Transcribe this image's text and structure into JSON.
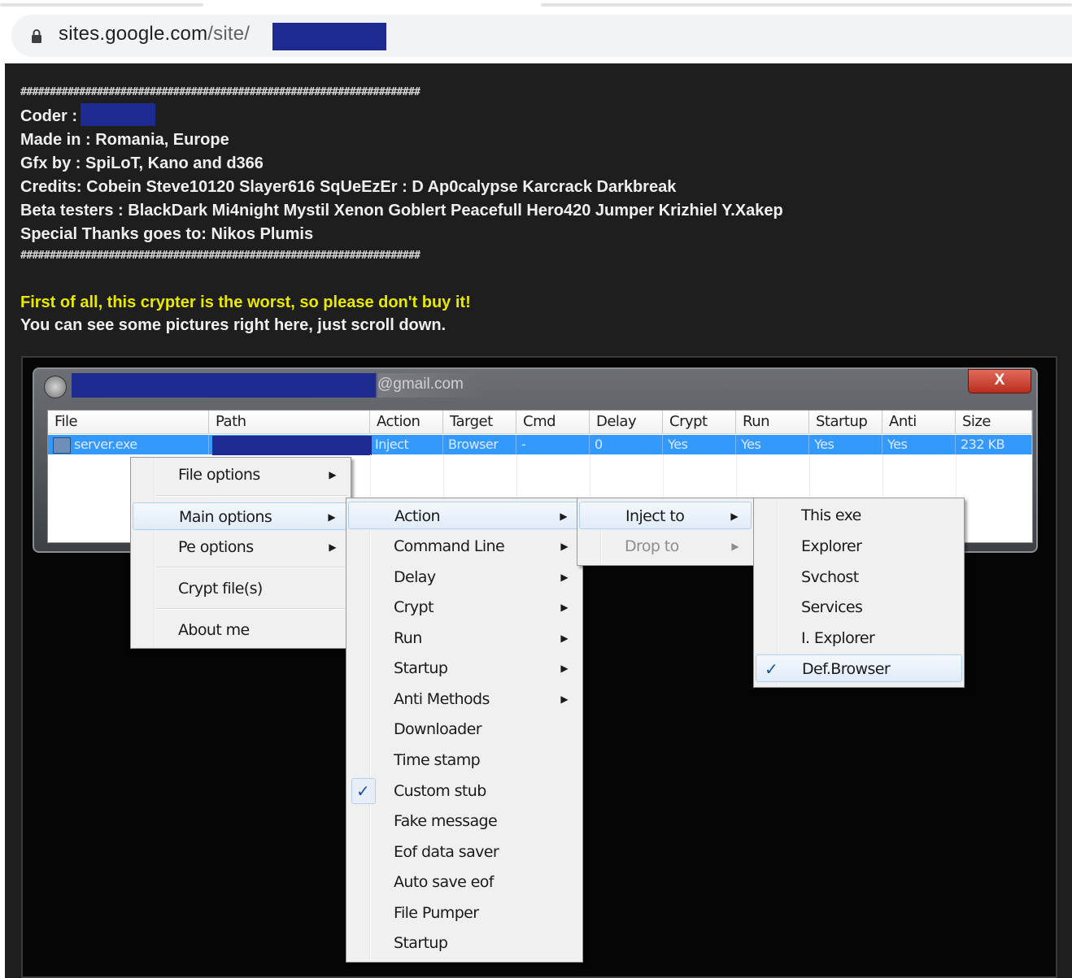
{
  "browser": {
    "url_domain": "sites.google.com",
    "url_path": "/site/"
  },
  "page": {
    "hash_line": "####################################################################",
    "coder_label": "Coder :",
    "made_in": "Made in : Romania, Europe",
    "gfx_by": "Gfx by : SpiLoT, Kano and d366",
    "credits": "Credits: Cobein Steve10120 Slayer616 SqUeEzEr : D Ap0calypse Karcrack Darkbreak",
    "beta_testers": "Beta testers : BlackDark Mi4night Mystil Xenon Goblert Peacefull Hero420 Jumper Krizhiel Y.Xakep",
    "special_thanks": "Special Thanks goes to: Nikos Plumis",
    "warning": "First of all, this crypter is the worst, so please don't buy it!",
    "scroll_note": "You can see some pictures right here, just scroll down.",
    "warning_color": "#e8e800"
  },
  "app": {
    "title_suffix": "@gmail.com",
    "close_glyph": "X",
    "columns": [
      "File",
      "Path",
      "Action",
      "Target",
      "Cmd",
      "Delay",
      "Crypt",
      "Run",
      "Startup",
      "Anti",
      "Size"
    ],
    "row": {
      "file": "server.exe",
      "action": "Inject",
      "target": "Browser",
      "cmd": "-",
      "delay": "0",
      "crypt": "Yes",
      "run": "Yes",
      "startup": "Yes",
      "anti": "Yes",
      "size": "232 KB"
    },
    "selection_color": "#3399ff"
  },
  "menus": {
    "main": {
      "file_options": "File options",
      "main_options": "Main options",
      "pe_options": "Pe options",
      "crypt_files": "Crypt file(s)",
      "about_me": "About me"
    },
    "main_options": {
      "action": "Action",
      "command_line": "Command Line",
      "delay": "Delay",
      "crypt": "Crypt",
      "run": "Run",
      "startup": "Startup",
      "anti_methods": "Anti Methods",
      "downloader": "Downloader",
      "time_stamp": "Time stamp",
      "custom_stub": "Custom stub",
      "fake_message": "Fake message",
      "eof_data_saver": "Eof data saver",
      "auto_save_eof": "Auto save eof",
      "file_pumper": "File Pumper",
      "startup2": "Startup"
    },
    "action": {
      "inject_to": "Inject to",
      "drop_to": "Drop to"
    },
    "inject_to": {
      "this_exe": "This exe",
      "explorer": "Explorer",
      "svchost": "Svchost",
      "services": "Services",
      "i_explorer": "I. Explorer",
      "def_browser": "Def.Browser"
    },
    "arrow": "▶",
    "check": "✓"
  }
}
